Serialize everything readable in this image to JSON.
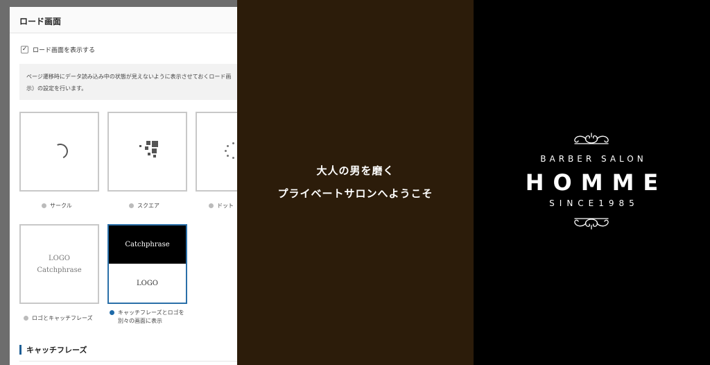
{
  "settings": {
    "panel_title": "ロード画面",
    "show_checkbox_label": "ロード画面を表示する",
    "description_line1": "ページ遷移時にデータ読み込み中の状態が見えないように表示させておくロード画",
    "description_line2": "示）の設定を行います。",
    "options": [
      {
        "label": "サークル"
      },
      {
        "label": "スクエア"
      },
      {
        "label": "ドット"
      },
      {
        "label": "ロゴとキャッチフレーズ",
        "preview_logo": "LOGO",
        "preview_catch": "Catchphrase"
      },
      {
        "label_line1": "キャッチフレーズとロゴを",
        "label_line2": "別々の画面に表示",
        "preview_catch": "Catchphrase",
        "preview_logo": "LOGO"
      }
    ],
    "section_title": "キャッチフレーズ",
    "accent_color": "#1e6aa8"
  },
  "middle": {
    "line1": "大人の男を磨く",
    "line2": "プライベートサロンへようこそ",
    "background": "#2c1c0a"
  },
  "brand": {
    "top": "BARBER SALON",
    "main": "HOMME",
    "since": "SINCE1985",
    "ornament_icon": "flourish-ornament"
  }
}
